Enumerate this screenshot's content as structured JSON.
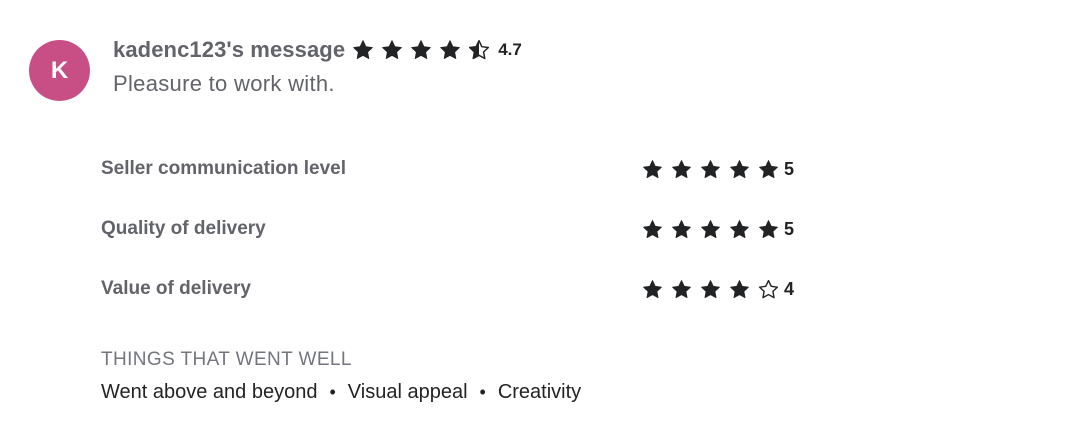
{
  "review": {
    "avatar_initial": "K",
    "avatar_color": "#c74f86",
    "title": "kadenc123's message",
    "overall_rating": 4.7,
    "overall_rating_text": "4.7",
    "overall_stars": [
      "star-full",
      "star-full",
      "star-full",
      "star-full",
      "star-half"
    ],
    "message": "Pleasure to work with."
  },
  "ratings": [
    {
      "label": "Seller communication level",
      "value": 5,
      "value_text": "5",
      "stars": [
        "star-full",
        "star-full",
        "star-full",
        "star-full",
        "star-full"
      ]
    },
    {
      "label": "Quality of delivery",
      "value": 5,
      "value_text": "5",
      "stars": [
        "star-full",
        "star-full",
        "star-full",
        "star-full",
        "star-full"
      ]
    },
    {
      "label": "Value of delivery",
      "value": 4,
      "value_text": "4",
      "stars": [
        "star-full",
        "star-full",
        "star-full",
        "star-full",
        "star-empty"
      ]
    }
  ],
  "highlights": {
    "title": "THINGS THAT WENT WELL",
    "tags": [
      "Went above and beyond",
      "Visual appeal",
      "Creativity"
    ],
    "separator": "•"
  },
  "colors": {
    "star": "#222325",
    "text_muted": "#62646a",
    "text_dark": "#222325"
  }
}
